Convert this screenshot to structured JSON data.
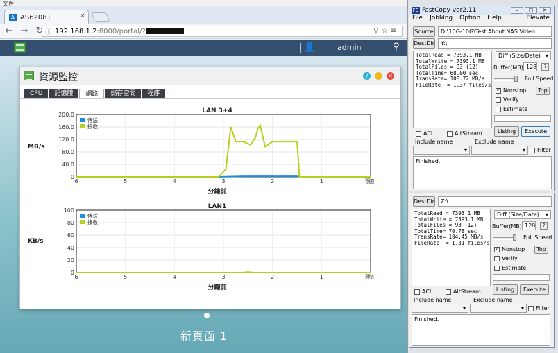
{
  "top_caption": "文件",
  "browser": {
    "tab_title": "AS6208T",
    "url_prefix": "192.168.1.2",
    "url_rest": ":8000/portal/?"
  },
  "adm": {
    "username": "admin",
    "new_page_label": "新頁面 1"
  },
  "monitor": {
    "title": "資源監控",
    "tabs": [
      "CPU",
      "記憶體",
      "網路",
      "儲存空間",
      "程序"
    ],
    "active_tab": "網路"
  },
  "chart_data": [
    {
      "type": "line",
      "title": "LAN 3+4",
      "ylabel": "MB/s",
      "xlabel": "分鐘前",
      "x_ticks": [
        "6",
        "5",
        "4",
        "3",
        "2",
        "1",
        "現在"
      ],
      "y_ticks": [
        "0",
        "40.0",
        "80.0",
        "120.0",
        "160.0",
        "200.0"
      ],
      "ylim": [
        0,
        200
      ],
      "xlim": [
        6,
        0
      ],
      "legend": [
        "傳送",
        "接收"
      ],
      "legend_placement": "top-left",
      "series": [
        {
          "name": "傳送",
          "color": "#1e8fd8",
          "x": [
            6,
            3.1,
            2.6,
            2.4,
            1.5,
            1.45,
            0
          ],
          "y": [
            0,
            0,
            2,
            2,
            2,
            0,
            0
          ]
        },
        {
          "name": "接收",
          "color": "#b7cf1d",
          "x": [
            6,
            3.1,
            2.95,
            2.85,
            2.75,
            2.6,
            2.45,
            2.35,
            2.3,
            2.25,
            2.15,
            2.0,
            1.85,
            1.6,
            1.5,
            1.45,
            0
          ],
          "y": [
            0,
            0,
            25,
            160,
            113,
            113,
            103,
            125,
            155,
            165,
            97,
            113,
            113,
            113,
            113,
            0,
            0
          ]
        }
      ]
    },
    {
      "type": "line",
      "title": "LAN1",
      "ylabel": "KB/s",
      "xlabel": "分鐘前",
      "x_ticks": [
        "6",
        "5",
        "4",
        "3",
        "2",
        "1",
        "現在"
      ],
      "y_ticks": [
        "0",
        "20",
        "40",
        "60",
        "80",
        "100"
      ],
      "ylim": [
        0,
        100
      ],
      "xlim": [
        6,
        0
      ],
      "legend": [
        "傳送",
        "接收"
      ],
      "legend_placement": "top-left",
      "series": [
        {
          "name": "傳送",
          "color": "#1e8fd8",
          "x": [
            6,
            0
          ],
          "y": [
            0,
            0
          ]
        },
        {
          "name": "接收",
          "color": "#b7cf1d",
          "x": [
            6,
            2.6,
            2.5,
            2.4,
            0
          ],
          "y": [
            0,
            0,
            1,
            0,
            0
          ]
        }
      ]
    }
  ],
  "fastcopy_top": {
    "title": "FastCopy ver2.11",
    "menu": [
      "File",
      "JobMng",
      "Option",
      "Help"
    ],
    "elevate": "Elevate",
    "source_label": "Source",
    "source_value": "D:\\10G-10G\\Test About NAS Video",
    "destdir_label": "DestDir",
    "dest_value": "Y:\\",
    "stats": "TotalRead = 7393.1 MB\nTotalWrite = 7393.1 MB\nTotalFiles = 93 (12)\nTotalTime= 68.00 sec\nTransRate= 108.72 MB/s\nFileRate  = 1.37 files/s",
    "mode": "Diff (Size/Date)",
    "buffer_label": "Buffer(MB)",
    "buffer_value": "128",
    "help_q": "?",
    "full_speed": "Full Speed",
    "nonstop": "Nonstop",
    "verify": "Verify",
    "estimate": "Estimate",
    "top_btn": "Top",
    "acl": "ACL",
    "altstream": "AltStream",
    "listing": "Listing",
    "execute": "Execute",
    "include_name": "Include name",
    "exclude_name": "Exclude name",
    "filter": "Filter",
    "log": "Finished."
  },
  "fastcopy_bottom": {
    "destdir_label": "DestDir",
    "dest_value": "Z:\\",
    "stats": "TotalRead = 7393.1 MB\nTotalWrite = 7393.1 MB\nTotalFiles = 93 (12)\nTotalTime= 70.78 sec\nTransRate= 104.45 MB/s\nFileRate  = 1.31 files/s",
    "mode": "Diff (Size/Date)",
    "buffer_label": "Buffer(MB)",
    "buffer_value": "128",
    "help_q": "?",
    "full_speed": "Full Speed",
    "nonstop": "Nonstop",
    "verify": "Verify",
    "estimate": "Estimate",
    "top_btn": "Top",
    "acl": "ACL",
    "altstream": "AltStream",
    "listing": "Listing",
    "execute": "Execute",
    "include_name": "Include name",
    "exclude_name": "Exclude name",
    "filter": "Filter",
    "log": "Finished."
  }
}
